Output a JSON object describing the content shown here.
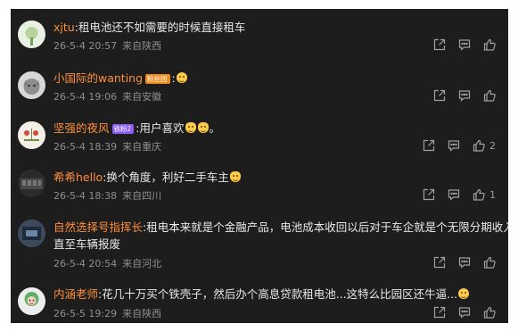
{
  "comments": [
    {
      "user": "xjtu",
      "text": ":租电池还不如需要的时候直接租车",
      "date": "26-5-4 20:57",
      "location": "来自陕西",
      "likes": ""
    },
    {
      "user": "小国际的wanting",
      "badge": "粉丝团",
      "text": ":",
      "date": "26-5-4 19:06",
      "location": "来自安徽",
      "likes": ""
    },
    {
      "user": "坚强的夜风",
      "badge": "铁粉2",
      "text": ":用户喜欢",
      "text_end": "。",
      "date": "26-5-4 18:39",
      "location": "来自重庆",
      "likes": "2"
    },
    {
      "user": "希希hello",
      "text": ":换个角度，利好二手车主",
      "date": "26-5-4 18:38",
      "location": "来自四川",
      "likes": "1"
    },
    {
      "user": "自然选择号指挥长",
      "text": ":租电本来就是个金融产品，电池成本收回以后对于车企就是个无限分期收入，",
      "text_line2": "直至车辆报废",
      "date": "26-5-4 20:54",
      "location": "来自河北",
      "likes": ""
    },
    {
      "user": "内涵老师",
      "text": ":花几十万买个铁壳子，然后办个高息贷款租电池...这特么比园区还牛逼...",
      "date": "26-5-5 19:29",
      "location": "来自陕西",
      "likes": ""
    }
  ],
  "icons": {
    "share": "share-icon",
    "reply": "comment-icon",
    "like": "thumbs-up-icon"
  },
  "colors": {
    "background": "#1d1d1d",
    "username": "#ff8f3a",
    "meta": "#8f8f8f",
    "text": "#e8e8e8"
  }
}
